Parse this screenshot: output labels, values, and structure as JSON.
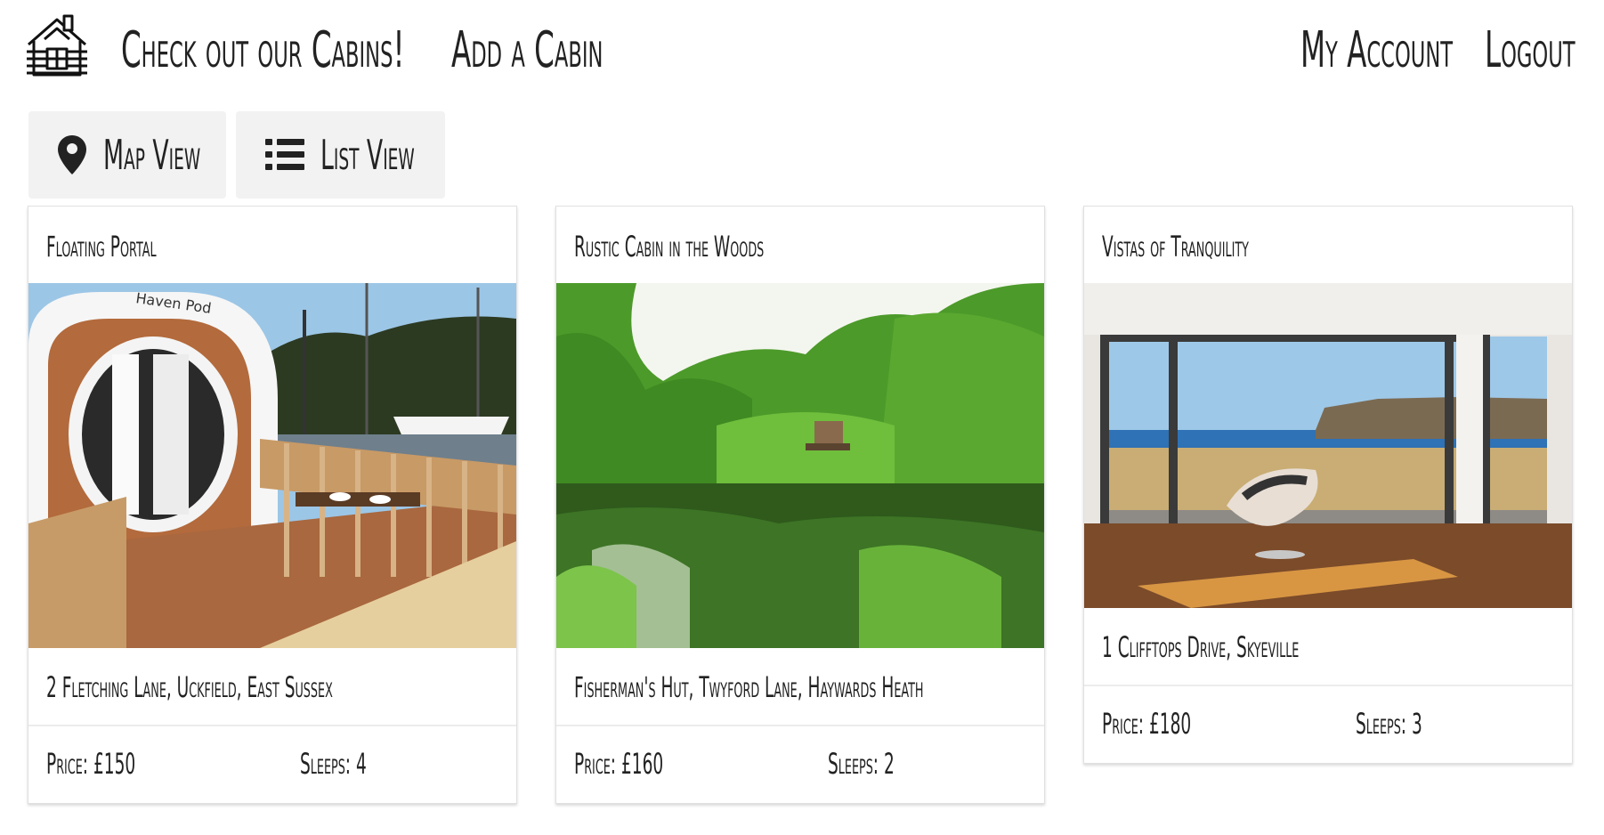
{
  "nav": {
    "brand_link": "Check out our Cabins!",
    "add_link": "Add a Cabin",
    "account_link": "My Account",
    "logout_link": "Logout",
    "logo_icon": "log-cabin-icon"
  },
  "view_toggle": {
    "map_label": "Map View",
    "map_icon": "map-pin-icon",
    "list_label": "List View",
    "list_icon": "list-icon"
  },
  "cabins": [
    {
      "title": "Floating Portal",
      "address": "2 Fletching Lane, Uckfield, East Sussex",
      "price": "Price: £150",
      "sleeps": "Sleeps: 4",
      "image_sign": "Haven Pod"
    },
    {
      "title": "Rustic Cabin in the Woods",
      "address": "Fisherman's Hut, Twyford Lane, Haywards Heath",
      "price": "Price: £160",
      "sleeps": "Sleeps: 2"
    },
    {
      "title": "Vistas of Tranquility",
      "address": "1 Clifftops Drive, Skyeville",
      "price": "Price: £180",
      "sleeps": "Sleeps: 3"
    }
  ]
}
